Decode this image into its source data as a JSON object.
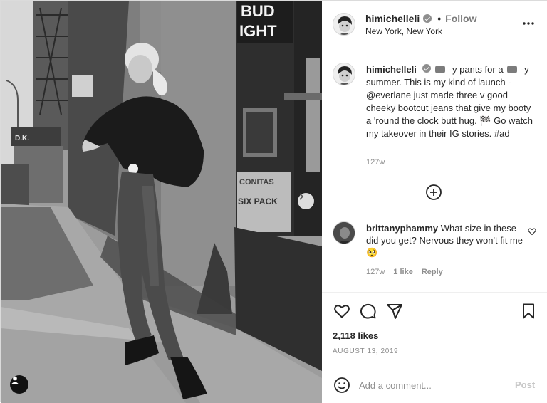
{
  "post": {
    "author": "himichelleli",
    "follow_label": "Follow",
    "separator": "•",
    "location": "New York, New York"
  },
  "photo": {
    "sign_top": "BUD",
    "sign_bottom": "IGHT",
    "shop_sign": "D.K.",
    "window_sign_top": "CONITAS",
    "window_sign_bottom": "SIX PACK"
  },
  "caption": {
    "author": "himichelleli",
    "text_1": "-y pants for a",
    "text_2": "-y summer. This is my kind of launch - @everlane just made three v good cheeky bootcut jeans that give my booty a 'round the clock butt hug. 🏁 Go watch my takeover in their IG stories. #ad",
    "time": "127w"
  },
  "comment": {
    "author": "brittanyphammy",
    "text": "What size in these did you get? Nervous they won't fit me 🥺",
    "time": "127w",
    "likes": "1 like",
    "reply": "Reply"
  },
  "engagement": {
    "likes": "2,118 likes",
    "date": "AUGUST 13, 2019"
  },
  "add_comment": {
    "placeholder": "Add a comment...",
    "post_label": "Post"
  },
  "icons": {
    "verified": "verified-badge-icon",
    "more": "more-options-icon",
    "load_more": "plus-circle-icon",
    "like": "heart-icon",
    "comment": "comment-bubble-icon",
    "share": "paper-plane-icon",
    "save": "bookmark-icon",
    "emoji": "smiley-icon",
    "next": "chevron-right-icon",
    "tag": "user-tag-icon"
  }
}
